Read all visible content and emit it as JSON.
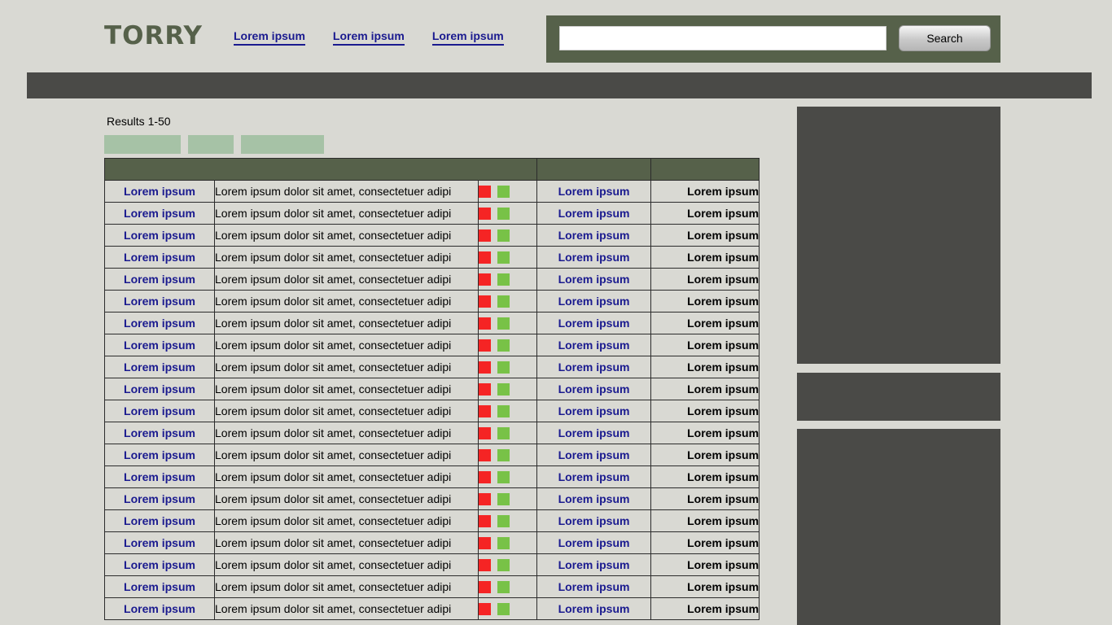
{
  "header": {
    "logo": "TORRY",
    "nav": [
      "Lorem ipsum",
      "Lorem ipsum",
      "Lorem ipsum"
    ],
    "search": {
      "value": "",
      "placeholder": "",
      "button_label": "Search"
    }
  },
  "results": {
    "summary": "Results 1-50",
    "rows": [
      {
        "name": "Lorem ipsum",
        "description": "Lorem ipsum dolor sit amet, consectetuer adipi",
        "link": "Lorem ipsum",
        "value": "Lorem ipsum"
      },
      {
        "name": "Lorem ipsum",
        "description": "Lorem ipsum dolor sit amet, consectetuer adipi",
        "link": "Lorem ipsum",
        "value": "Lorem ipsum"
      },
      {
        "name": "Lorem ipsum",
        "description": "Lorem ipsum dolor sit amet, consectetuer adipi",
        "link": "Lorem ipsum",
        "value": "Lorem ipsum"
      },
      {
        "name": "Lorem ipsum",
        "description": "Lorem ipsum dolor sit amet, consectetuer adipi",
        "link": "Lorem ipsum",
        "value": "Lorem ipsum"
      },
      {
        "name": "Lorem ipsum",
        "description": "Lorem ipsum dolor sit amet, consectetuer adipi",
        "link": "Lorem ipsum",
        "value": "Lorem ipsum"
      },
      {
        "name": "Lorem ipsum",
        "description": "Lorem ipsum dolor sit amet, consectetuer adipi",
        "link": "Lorem ipsum",
        "value": "Lorem ipsum"
      },
      {
        "name": "Lorem ipsum",
        "description": "Lorem ipsum dolor sit amet, consectetuer adipi",
        "link": "Lorem ipsum",
        "value": "Lorem ipsum"
      },
      {
        "name": "Lorem ipsum",
        "description": "Lorem ipsum dolor sit amet, consectetuer adipi",
        "link": "Lorem ipsum",
        "value": "Lorem ipsum"
      },
      {
        "name": "Lorem ipsum",
        "description": "Lorem ipsum dolor sit amet, consectetuer adipi",
        "link": "Lorem ipsum",
        "value": "Lorem ipsum"
      },
      {
        "name": "Lorem ipsum",
        "description": "Lorem ipsum dolor sit amet, consectetuer adipi",
        "link": "Lorem ipsum",
        "value": "Lorem ipsum"
      },
      {
        "name": "Lorem ipsum",
        "description": "Lorem ipsum dolor sit amet, consectetuer adipi",
        "link": "Lorem ipsum",
        "value": "Lorem ipsum"
      },
      {
        "name": "Lorem ipsum",
        "description": "Lorem ipsum dolor sit amet, consectetuer adipi",
        "link": "Lorem ipsum",
        "value": "Lorem ipsum"
      },
      {
        "name": "Lorem ipsum",
        "description": "Lorem ipsum dolor sit amet, consectetuer adipi",
        "link": "Lorem ipsum",
        "value": "Lorem ipsum"
      },
      {
        "name": "Lorem ipsum",
        "description": "Lorem ipsum dolor sit amet, consectetuer adipi",
        "link": "Lorem ipsum",
        "value": "Lorem ipsum"
      },
      {
        "name": "Lorem ipsum",
        "description": "Lorem ipsum dolor sit amet, consectetuer adipi",
        "link": "Lorem ipsum",
        "value": "Lorem ipsum"
      },
      {
        "name": "Lorem ipsum",
        "description": "Lorem ipsum dolor sit amet, consectetuer adipi",
        "link": "Lorem ipsum",
        "value": "Lorem ipsum"
      },
      {
        "name": "Lorem ipsum",
        "description": "Lorem ipsum dolor sit amet, consectetuer adipi",
        "link": "Lorem ipsum",
        "value": "Lorem ipsum"
      },
      {
        "name": "Lorem ipsum",
        "description": "Lorem ipsum dolor sit amet, consectetuer adipi",
        "link": "Lorem ipsum",
        "value": "Lorem ipsum"
      },
      {
        "name": "Lorem ipsum",
        "description": "Lorem ipsum dolor sit amet, consectetuer adipi",
        "link": "Lorem ipsum",
        "value": "Lorem ipsum"
      },
      {
        "name": "Lorem ipsum",
        "description": "Lorem ipsum dolor sit amet, consectetuer adipi",
        "link": "Lorem ipsum",
        "value": "Lorem ipsum"
      }
    ]
  },
  "colors": {
    "page_background": "#d9d9d3",
    "brand_green": "#56614a",
    "dark_bar": "#4a4a47",
    "link_blue": "#1a1a8f",
    "filter_tab": "#a6c2a6",
    "status_red": "#f52424",
    "status_green": "#78c247"
  },
  "icons": {
    "status_bad": "red-square-icon",
    "status_good": "green-square-icon"
  }
}
